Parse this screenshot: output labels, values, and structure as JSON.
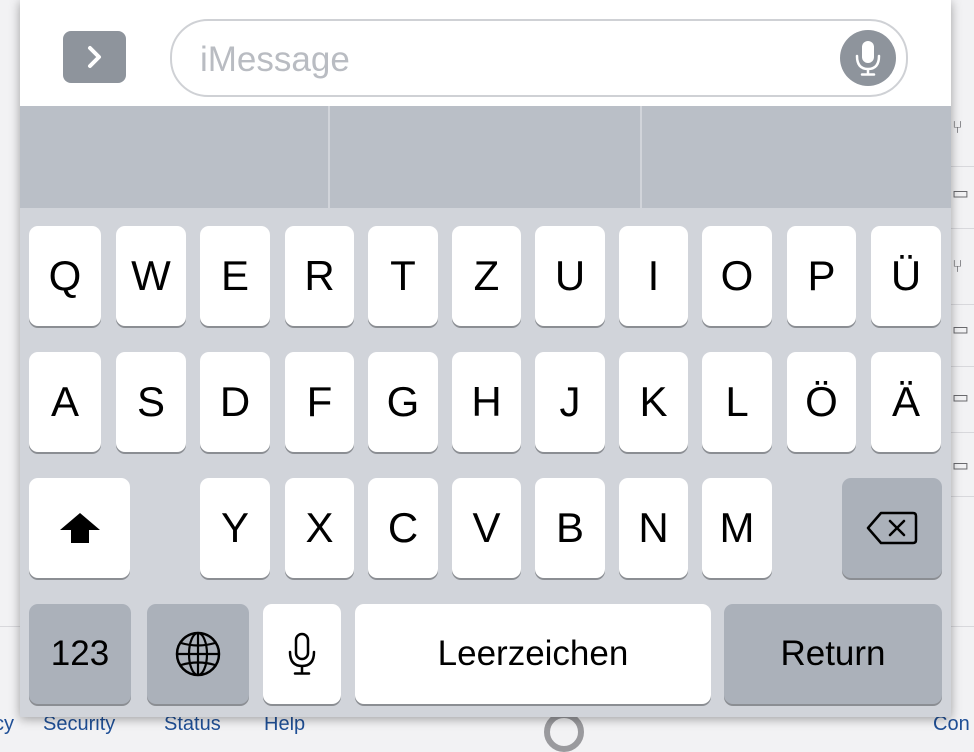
{
  "background": {
    "footer_links": [
      "cy",
      "Security",
      "Status",
      "Help",
      "Con"
    ]
  },
  "message_bar": {
    "placeholder": "iMessage",
    "expand_icon": "chevron-right-icon",
    "dictation_icon": "microphone-icon"
  },
  "suggestions": [
    "",
    "",
    ""
  ],
  "keyboard": {
    "row1": [
      "Q",
      "W",
      "E",
      "R",
      "T",
      "Z",
      "U",
      "I",
      "O",
      "P",
      "Ü"
    ],
    "row2": [
      "A",
      "S",
      "D",
      "F",
      "G",
      "H",
      "J",
      "K",
      "L",
      "Ö",
      "Ä"
    ],
    "row3": [
      "Y",
      "X",
      "C",
      "V",
      "B",
      "N",
      "M"
    ],
    "shift_icon": "shift-arrow-icon",
    "backspace_icon": "backspace-icon",
    "numbers_label": "123",
    "globe_icon": "globe-icon",
    "mic_icon": "microphone-icon",
    "space_label": "Leerzeichen",
    "return_label": "Return"
  },
  "colors": {
    "keyboard_bg": "#d1d4da",
    "key_bg": "#ffffff",
    "dark_key_bg": "#abb1ba",
    "suggestion_bg": "#babfc7",
    "link": "#1f4f96"
  }
}
